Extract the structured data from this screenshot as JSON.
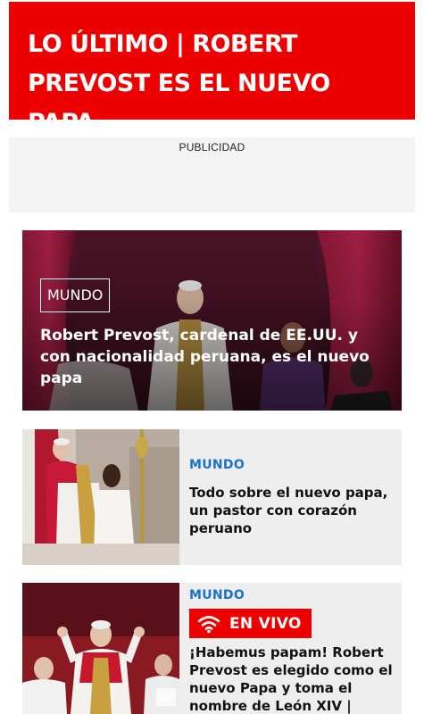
{
  "breaking_banner": {
    "text": "LO ÚLTIMO | ROBERT PREVOST ES EL NUEVO PAPA",
    "background": "#ee0000"
  },
  "advertisement": {
    "label": "PUBLICIDAD"
  },
  "hero_article": {
    "category": "MUNDO",
    "title": "Robert Prevost, cardenal de EE.UU. y con nacionalidad peruana, es el nuevo papa"
  },
  "articles": [
    {
      "category": "MUNDO",
      "title": "Todo sobre el nuevo papa, un pastor con corazón peruano"
    },
    {
      "category": "MUNDO",
      "live_badge": "EN VIVO",
      "live_icon": "wifi-icon",
      "title": "¡Habemus papam! Robert Prevost es elegido como el nuevo Papa y toma el nombre de León XIV | VIDEO"
    }
  ],
  "colors": {
    "accent_red": "#ee0000",
    "category_blue": "#1a73c9"
  }
}
